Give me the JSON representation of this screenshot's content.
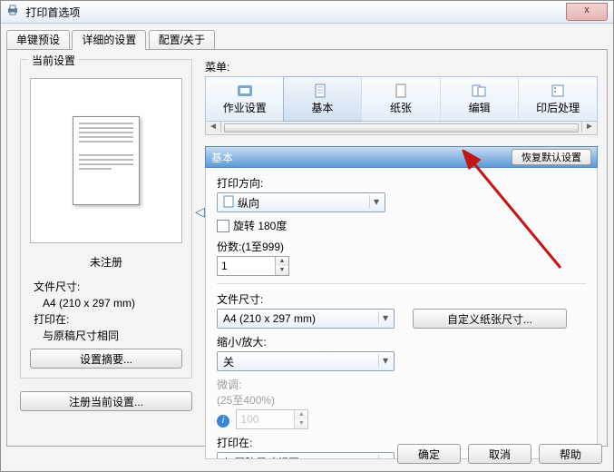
{
  "window_title": "打印首选项",
  "close_label": "x",
  "tabs": [
    "单键预设",
    "详细的设置",
    "配置/关于"
  ],
  "active_tab_index": 1,
  "left": {
    "current_settings_legend": "当前设置",
    "unregistered": "未注册",
    "doc_size_label": "文件尺寸:",
    "doc_size_value": "A4 (210 x 297 mm)",
    "print_on_label": "打印在:",
    "print_on_value": "与原稿尺寸相同",
    "summary_btn": "设置摘要...",
    "register_btn": "注册当前设置..."
  },
  "right": {
    "menus_label": "菜单:",
    "toolbar": [
      {
        "id": "job",
        "label": "作业设置"
      },
      {
        "id": "basic",
        "label": "基本"
      },
      {
        "id": "paper",
        "label": "纸张"
      },
      {
        "id": "edit",
        "label": "编辑"
      },
      {
        "id": "finish",
        "label": "印后处理"
      }
    ],
    "toolbar_selected_index": 1,
    "section_title": "基本",
    "restore_btn": "恢复默认设置",
    "orientation_label": "打印方向:",
    "orientation_value": "纵向",
    "rotate_label": "旋转 180度",
    "rotate_checked": false,
    "copies_label": "份数:(1至999)",
    "copies_value": "1",
    "doc_size_label": "文件尺寸:",
    "doc_size_value": "A4 (210 x 297 mm)",
    "custom_paper_btn": "自定义纸张尺寸...",
    "scale_label": "缩小/放大:",
    "scale_value": "关",
    "fine_label": "微调:",
    "fine_hint": "(25至400%)",
    "fine_value": "100",
    "print_on_label": "打印在:",
    "print_on_value": "与原稿尺寸相同"
  },
  "dialog_buttons": {
    "ok": "确定",
    "cancel": "取消",
    "help": "帮助"
  }
}
